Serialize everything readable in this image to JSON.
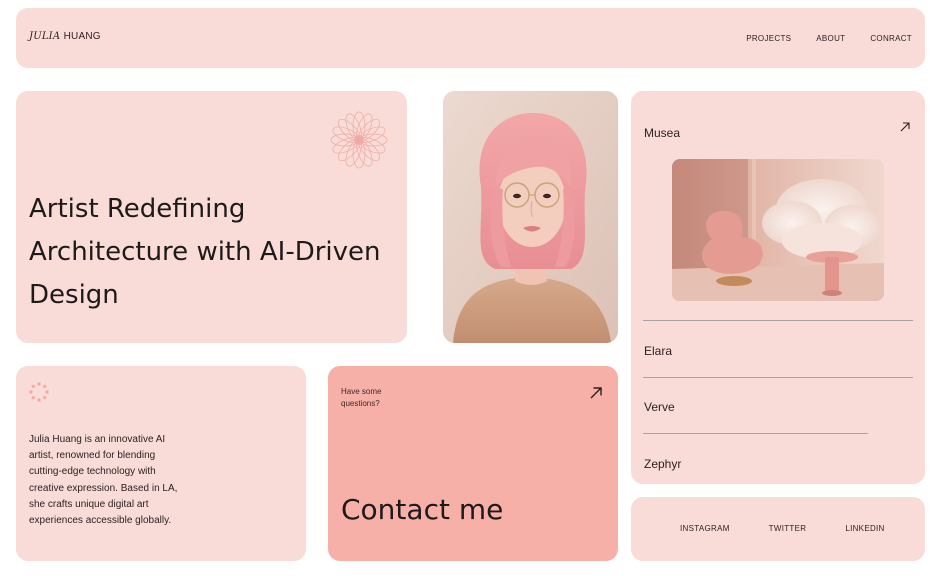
{
  "header": {
    "brand_first": "JULIA",
    "brand_last": "HUANG",
    "nav": [
      "PROJECTS",
      "ABOUT",
      "CONRACT"
    ]
  },
  "hero": {
    "title": "Artist Redefining Architecture with AI-Driven Design"
  },
  "projects": {
    "featured": "Musea",
    "items": [
      "Elara",
      "Verve",
      "Zephyr"
    ]
  },
  "bio": {
    "text": "Julia Huang is an innovative AI artist, renowned for blending cutting-edge technology with creative expression. Based in LA, she crafts unique digital art experiences accessible globally."
  },
  "contact": {
    "question": "Have some questions?",
    "title": "Contact me"
  },
  "social": [
    "INSTAGRAM",
    "TWITTER",
    "LINKEDIN"
  ],
  "colors": {
    "card": "#f9dbd7",
    "contact": "#f7b0a8",
    "text": "#2b1f1f"
  },
  "icons": [
    "flower-ornament-icon",
    "arrow-up-right-icon",
    "dotted-circle-icon"
  ]
}
